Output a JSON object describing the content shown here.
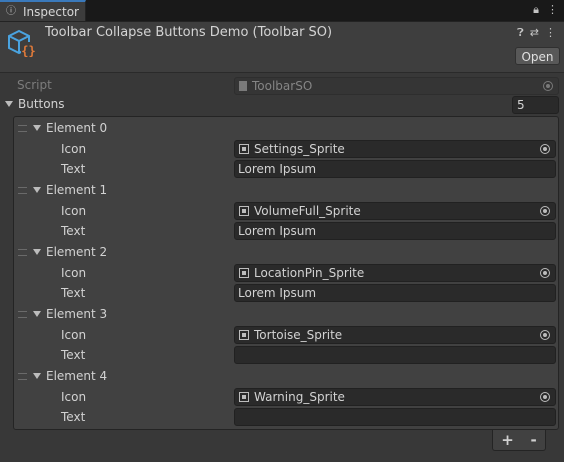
{
  "tab": {
    "label": "Inspector"
  },
  "header": {
    "title": "Toolbar Collapse Buttons Demo (Toolbar SO)",
    "open_label": "Open"
  },
  "script_row": {
    "label": "Script",
    "value": "ToolbarSO"
  },
  "buttons": {
    "label": "Buttons",
    "count": "5"
  },
  "elements": [
    {
      "name": "Element 0",
      "icon_label": "Icon",
      "icon_value": "Settings_Sprite",
      "text_label": "Text",
      "text_value": "Lorem Ipsum"
    },
    {
      "name": "Element 1",
      "icon_label": "Icon",
      "icon_value": "VolumeFull_Sprite",
      "text_label": "Text",
      "text_value": "Lorem Ipsum"
    },
    {
      "name": "Element 2",
      "icon_label": "Icon",
      "icon_value": "LocationPin_Sprite",
      "text_label": "Text",
      "text_value": "Lorem Ipsum"
    },
    {
      "name": "Element 3",
      "icon_label": "Icon",
      "icon_value": "Tortoise_Sprite",
      "text_label": "Text",
      "text_value": ""
    },
    {
      "name": "Element 4",
      "icon_label": "Icon",
      "icon_value": "Warning_Sprite",
      "text_label": "Text",
      "text_value": ""
    }
  ],
  "footer": {
    "add": "+",
    "remove": "-"
  },
  "colors": {
    "background": "#383838",
    "field": "#2a2a2a",
    "accent": "#3a79bb",
    "icon_orange": "#e07a3a",
    "icon_blue": "#4aa3df"
  },
  "icons": {
    "tab": "inspector-icon",
    "lock": "lock-icon",
    "menu": "kebab-menu-icon",
    "help": "help-icon",
    "preset": "sliders-icon",
    "asset": "scriptable-object-icon"
  }
}
